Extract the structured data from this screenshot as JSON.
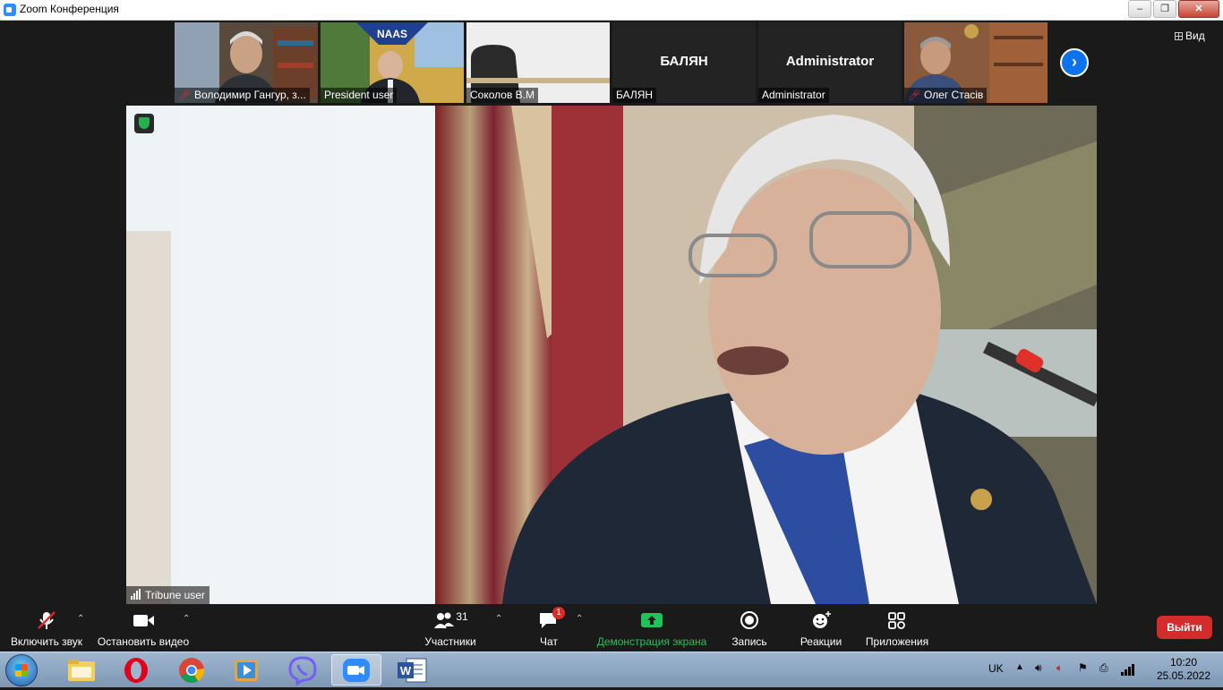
{
  "window": {
    "title": "Zoom Конференция",
    "min": "–",
    "max": "❐",
    "close": "✕"
  },
  "thumbnails": [
    {
      "name": "Володимир Гангур, з...",
      "muted": true,
      "video": true
    },
    {
      "name": "President user",
      "muted": false,
      "video": true
    },
    {
      "name": "Соколов В.М",
      "muted": false,
      "video": true
    },
    {
      "name": "БАЛЯН",
      "muted": false,
      "video": false,
      "center_name": "БАЛЯН"
    },
    {
      "name": "Administrator",
      "muted": false,
      "video": false,
      "center_name": "Administrator"
    },
    {
      "name": "Олег Стасів",
      "muted": true,
      "video": true
    }
  ],
  "view_label": "Вид",
  "active_speaker": {
    "name": "Tribune user"
  },
  "toolbar": {
    "unmute": "Включить звук",
    "stop_video": "Остановить видео",
    "participants_count": "31",
    "participants": "Участники",
    "chat": "Чат",
    "chat_badge": "1",
    "share": "Демонстрация экрана",
    "record": "Запись",
    "reactions": "Реакции",
    "apps": "Приложения",
    "leave": "Выйти"
  },
  "taskbar": {
    "lang": "UK",
    "time": "10:20",
    "date": "25.05.2022",
    "apps": [
      "explorer",
      "opera",
      "chrome",
      "media-player",
      "viber",
      "zoom",
      "word"
    ]
  },
  "colors": {
    "accent": "#0e72ed",
    "share_green": "#23c35b",
    "leave_red": "#d22c2c"
  }
}
